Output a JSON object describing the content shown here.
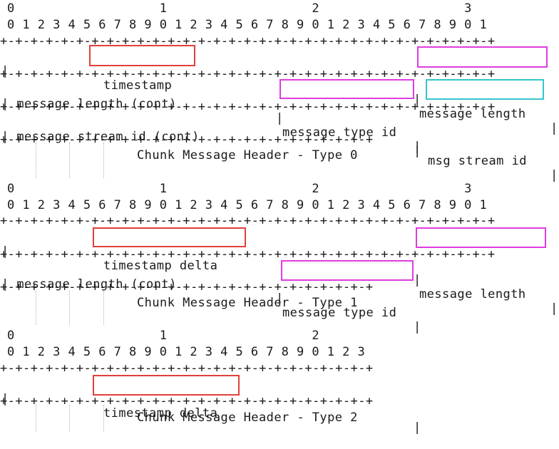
{
  "diagrams": [
    {
      "header_tens": "0                   1                   2                   3",
      "header_units": "0 1 2 3 4 5 6 7 8 9 0 1 2 3 4 5 6 7 8 9 0 1 2 3 4 5 6 7 8 9 0 1",
      "border_full": "+-+-+-+-+-+-+-+-+-+-+-+-+-+-+-+-+-+-+-+-+-+-+-+-+-+-+-+-+-+-+-+-+",
      "row1_line": "|        timestamp                              |message length  |",
      "row2_line": "| message length (cont)          |message type id | msg stream id  |",
      "row3_line": "| message stream id (cont)                       |",
      "border_short": "+-+-+-+-+-+-+-+-+-+-+-+-+-+-+-+-+-+-+-+-+-+-+-+-+",
      "caption": "Chunk Message Header - Type 0",
      "labels": {
        "timestamp": "timestamp",
        "message_length": "message length",
        "message_type_id": "message type id",
        "msg_stream_id": "msg stream id"
      }
    },
    {
      "header_tens": "0                   1                   2                   3",
      "header_units": "0 1 2 3 4 5 6 7 8 9 0 1 2 3 4 5 6 7 8 9 0 1 2 3 4 5 6 7 8 9 0 1",
      "border_full": "+-+-+-+-+-+-+-+-+-+-+-+-+-+-+-+-+-+-+-+-+-+-+-+-+-+-+-+-+-+-+-+-+",
      "row1_line": "|        timestamp delta                        |message length  |",
      "row2_line": "| message length (cont)          |message type id|",
      "border_short": "+-+-+-+-+-+-+-+-+-+-+-+-+-+-+-+-+-+-+-+-+-+-+-+-+",
      "caption": "Chunk Message Header - Type 1",
      "labels": {
        "timestamp_delta": "timestamp delta",
        "message_length": "message length",
        "message_type_id": "message type id"
      }
    },
    {
      "header_tens": "0                   1                   2",
      "header_units": "0 1 2 3 4 5 6 7 8 9 0 1 2 3 4 5 6 7 8 9 0 1 2 3",
      "border_short": "+-+-+-+-+-+-+-+-+-+-+-+-+-+-+-+-+-+-+-+-+-+-+-+-+",
      "row1_line": "|        timestamp delta                         |",
      "caption": "Chunk Message Header - Type 2",
      "labels": {
        "timestamp_delta": "timestamp delta"
      }
    }
  ],
  "colors": {
    "red": "#e0403c",
    "magenta": "#e03ce0",
    "cyan": "#33c6cc",
    "text": "#1a1a1a"
  }
}
